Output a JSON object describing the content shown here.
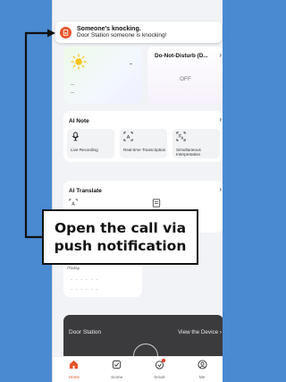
{
  "notification": {
    "title": "Someone's knocking.",
    "body": "Door Station  someone is knocking!",
    "icon": "doorbell-icon"
  },
  "weather": {
    "temperature": "-",
    "line1": "--",
    "line2": "--",
    "icon": "sun-icon"
  },
  "dnd": {
    "title": "Do-Not-Disturb (D...",
    "state": "OFF"
  },
  "ai_note": {
    "title": "AI Note",
    "tiles": [
      {
        "label": "Live Recording",
        "icon": "microphone-icon"
      },
      {
        "label": "Real-time Transcription",
        "icon": "transcription-icon"
      },
      {
        "label": "Simultaneous Interpretation",
        "icon": "interpretation-icon"
      }
    ]
  },
  "ai_translate": {
    "title": "AI Translate"
  },
  "today": {
    "label": "/Today",
    "dash1": "- - - - - -",
    "dash2": "- - - - -  -"
  },
  "door_station": {
    "title": "Door Station",
    "view": "View the Device"
  },
  "tabbar": [
    {
      "label": "Home",
      "icon": "home-icon",
      "active": true
    },
    {
      "label": "Scene",
      "icon": "scene-icon",
      "active": false
    },
    {
      "label": "Smart",
      "icon": "smart-icon",
      "active": false
    },
    {
      "label": "Me",
      "icon": "me-icon",
      "active": false
    }
  ],
  "callout": {
    "line1": "Open the call via",
    "line2": "push notification"
  },
  "colors": {
    "accent": "#e8542a",
    "background": "#4a8ad0",
    "callout_border": "#111111"
  }
}
